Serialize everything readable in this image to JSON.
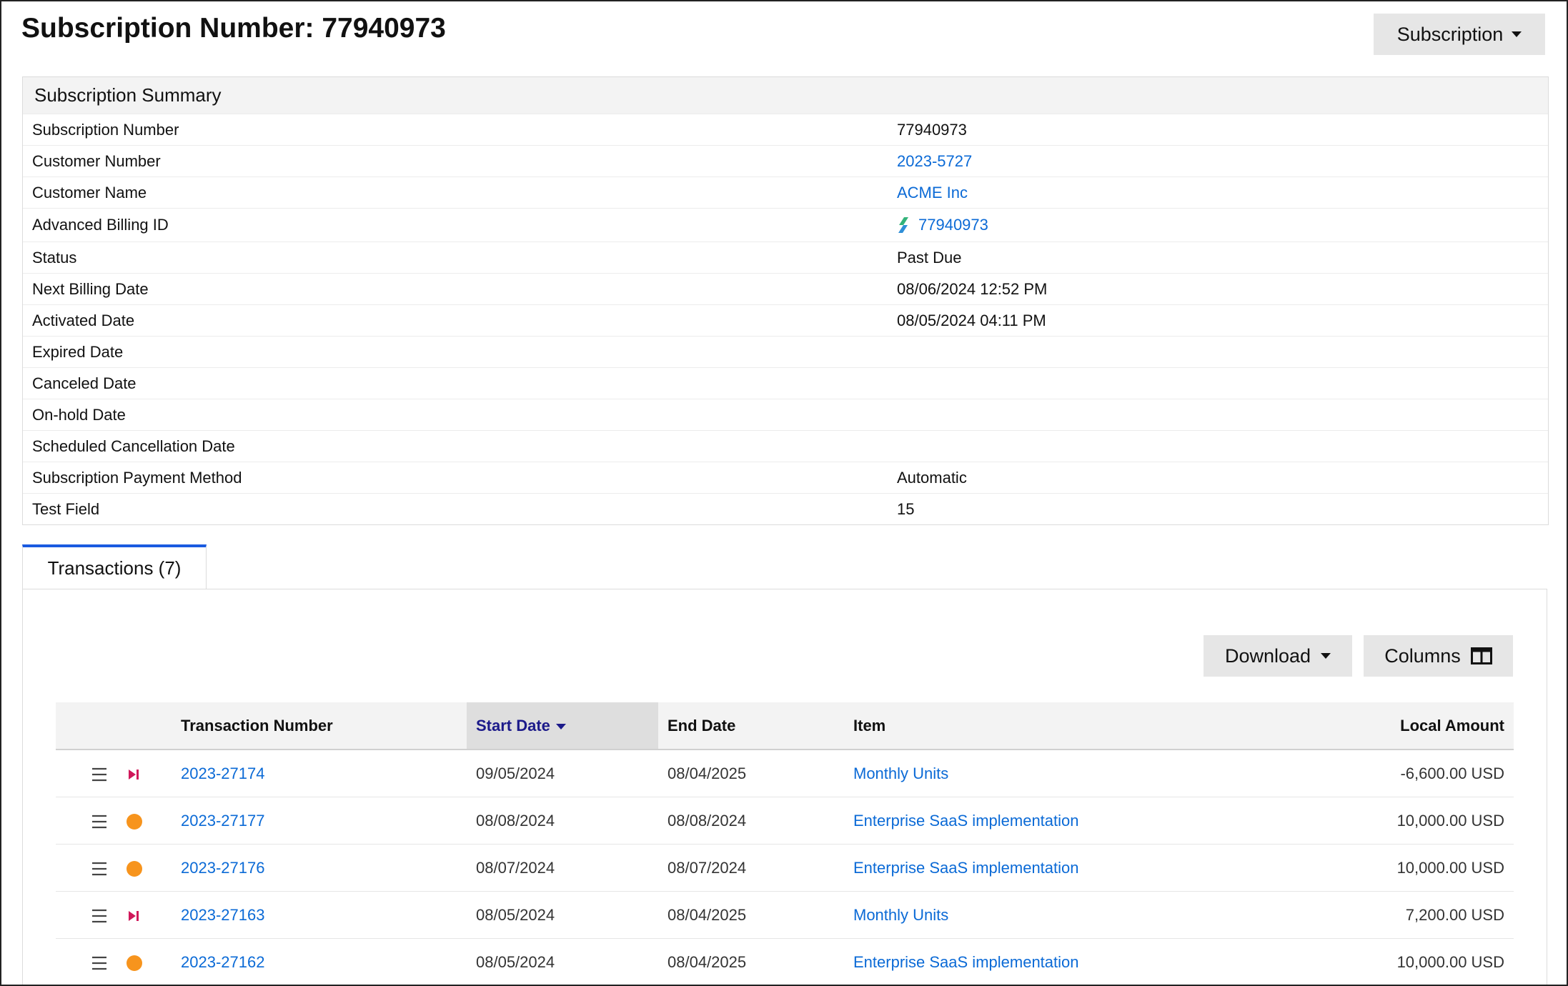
{
  "page": {
    "title": "Subscription Number: 77940973",
    "record_menu_label": "Subscription"
  },
  "summary": {
    "heading": "Subscription Summary",
    "rows": [
      {
        "label": "Subscription Number",
        "value": "77940973",
        "link": false
      },
      {
        "label": "Customer Number",
        "value": "2023-5727",
        "link": true
      },
      {
        "label": "Customer Name",
        "value": "ACME Inc",
        "link": true
      },
      {
        "label": "Advanced Billing ID",
        "value": "77940973",
        "link": true,
        "icon": "advanced-billing-logo-icon"
      },
      {
        "label": "Status",
        "value": "Past Due",
        "link": false
      },
      {
        "label": "Next Billing Date",
        "value": "08/06/2024 12:52 PM",
        "link": false
      },
      {
        "label": "Activated Date",
        "value": "08/05/2024 04:11 PM",
        "link": false
      },
      {
        "label": "Expired Date",
        "value": "",
        "link": false
      },
      {
        "label": "Canceled Date",
        "value": "",
        "link": false
      },
      {
        "label": "On-hold Date",
        "value": "",
        "link": false
      },
      {
        "label": "Scheduled Cancellation Date",
        "value": "",
        "link": false
      },
      {
        "label": "Subscription Payment Method",
        "value": "Automatic",
        "link": false
      },
      {
        "label": "Test Field",
        "value": "15",
        "link": false
      }
    ]
  },
  "tabs": [
    {
      "label": "Transactions (7)",
      "active": true
    }
  ],
  "toolbar": {
    "download_label": "Download",
    "columns_label": "Columns"
  },
  "table": {
    "columns": [
      "Transaction Number",
      "Start Date",
      "End Date",
      "Item",
      "Local Amount"
    ],
    "sorted_column": "Start Date",
    "sort_direction": "descending",
    "rows": [
      {
        "status": "skip",
        "number": "2023-27174",
        "start": "09/05/2024",
        "end": "08/04/2025",
        "item": "Monthly Units",
        "amount": "-6,600.00 USD"
      },
      {
        "status": "pending",
        "number": "2023-27177",
        "start": "08/08/2024",
        "end": "08/08/2024",
        "item": "Enterprise SaaS implementation",
        "amount": "10,000.00 USD"
      },
      {
        "status": "pending",
        "number": "2023-27176",
        "start": "08/07/2024",
        "end": "08/07/2024",
        "item": "Enterprise SaaS implementation",
        "amount": "10,000.00 USD"
      },
      {
        "status": "skip",
        "number": "2023-27163",
        "start": "08/05/2024",
        "end": "08/04/2025",
        "item": "Monthly Units",
        "amount": "7,200.00 USD"
      },
      {
        "status": "pending",
        "number": "2023-27162",
        "start": "08/05/2024",
        "end": "08/04/2025",
        "item": "Enterprise SaaS implementation",
        "amount": "10,000.00 USD"
      }
    ]
  },
  "colors": {
    "link": "#0b6ad6",
    "tab_accent": "#1a5ae0",
    "status_pending": "#f7941d",
    "status_skip": "#d0185a",
    "sorted_header_text": "#1c1a8a"
  }
}
